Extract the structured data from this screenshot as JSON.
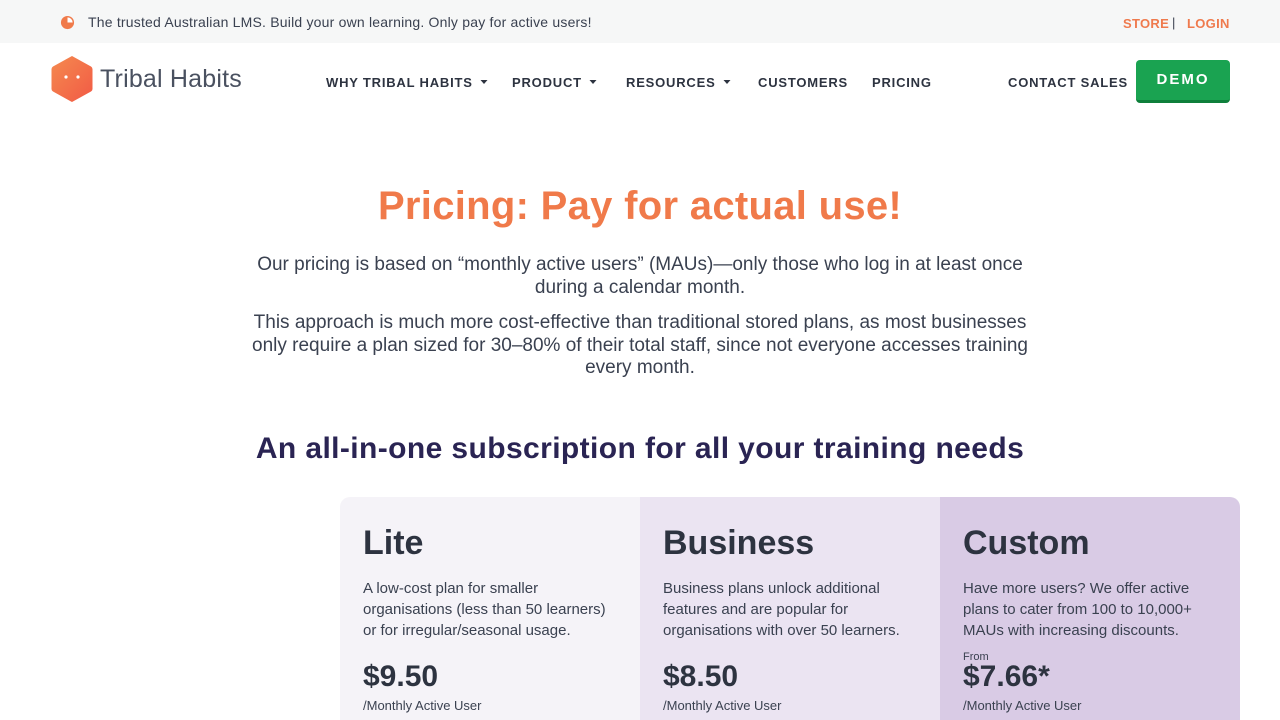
{
  "topbar": {
    "tagline": "The trusted Australian LMS. Build your own learning. Only pay for active users!",
    "store_label": "STORE",
    "separator": "|",
    "login_label": "LOGIN"
  },
  "logo": {
    "brand": "Tribal Habits"
  },
  "nav": {
    "items": [
      {
        "label": "WHY TRIBAL HABITS"
      },
      {
        "label": "PRODUCT"
      },
      {
        "label": "RESOURCES"
      },
      {
        "label": "CUSTOMERS"
      },
      {
        "label": "PRICING"
      },
      {
        "label": "CONTACT SALES"
      }
    ],
    "demo_label": "DEMO"
  },
  "hero": {
    "title": "Pricing: Pay for actual use!",
    "p1": "Our pricing is based on “monthly active users” (MAUs)—only those who log in at least once during a calendar month.",
    "p2": "This approach is much more cost-effective than traditional stored plans, as most businesses only require a plan sized for 30–80% of their total staff, since not everyone accesses training every month."
  },
  "subheading": "An all-in-one subscription for all your training needs",
  "plans": [
    {
      "name": "Lite",
      "description": "A low-cost plan for smaller organisations (less than 50 learners) or for irregular/seasonal usage.",
      "from": "",
      "price": "$9.50",
      "unit": "/Monthly Active User"
    },
    {
      "name": "Business",
      "description": "Business plans unlock additional features and are popular for organisations with over 50 learners.",
      "from": "",
      "price": "$8.50",
      "unit": "/Monthly Active User"
    },
    {
      "name": "Custom",
      "description": "Have more users? We offer active plans to cater from 100 to 10,000+ MAUs with increasing discounts.",
      "from": "From",
      "price": "$7.66*",
      "unit": "/Monthly Active User"
    }
  ],
  "colors": {
    "accent": "#ef7a4d",
    "demo_green": "#1aa351",
    "heading_navy": "#2a2453",
    "lite_bg": "#f5f3f8",
    "business_bg": "#ebe4f2",
    "custom_bg": "#d9cbe5"
  },
  "icons": {
    "topbar": "pie-chart-icon",
    "nav_dropdown": "chevron-down-icon",
    "logo": "hexagon-logo-icon"
  }
}
